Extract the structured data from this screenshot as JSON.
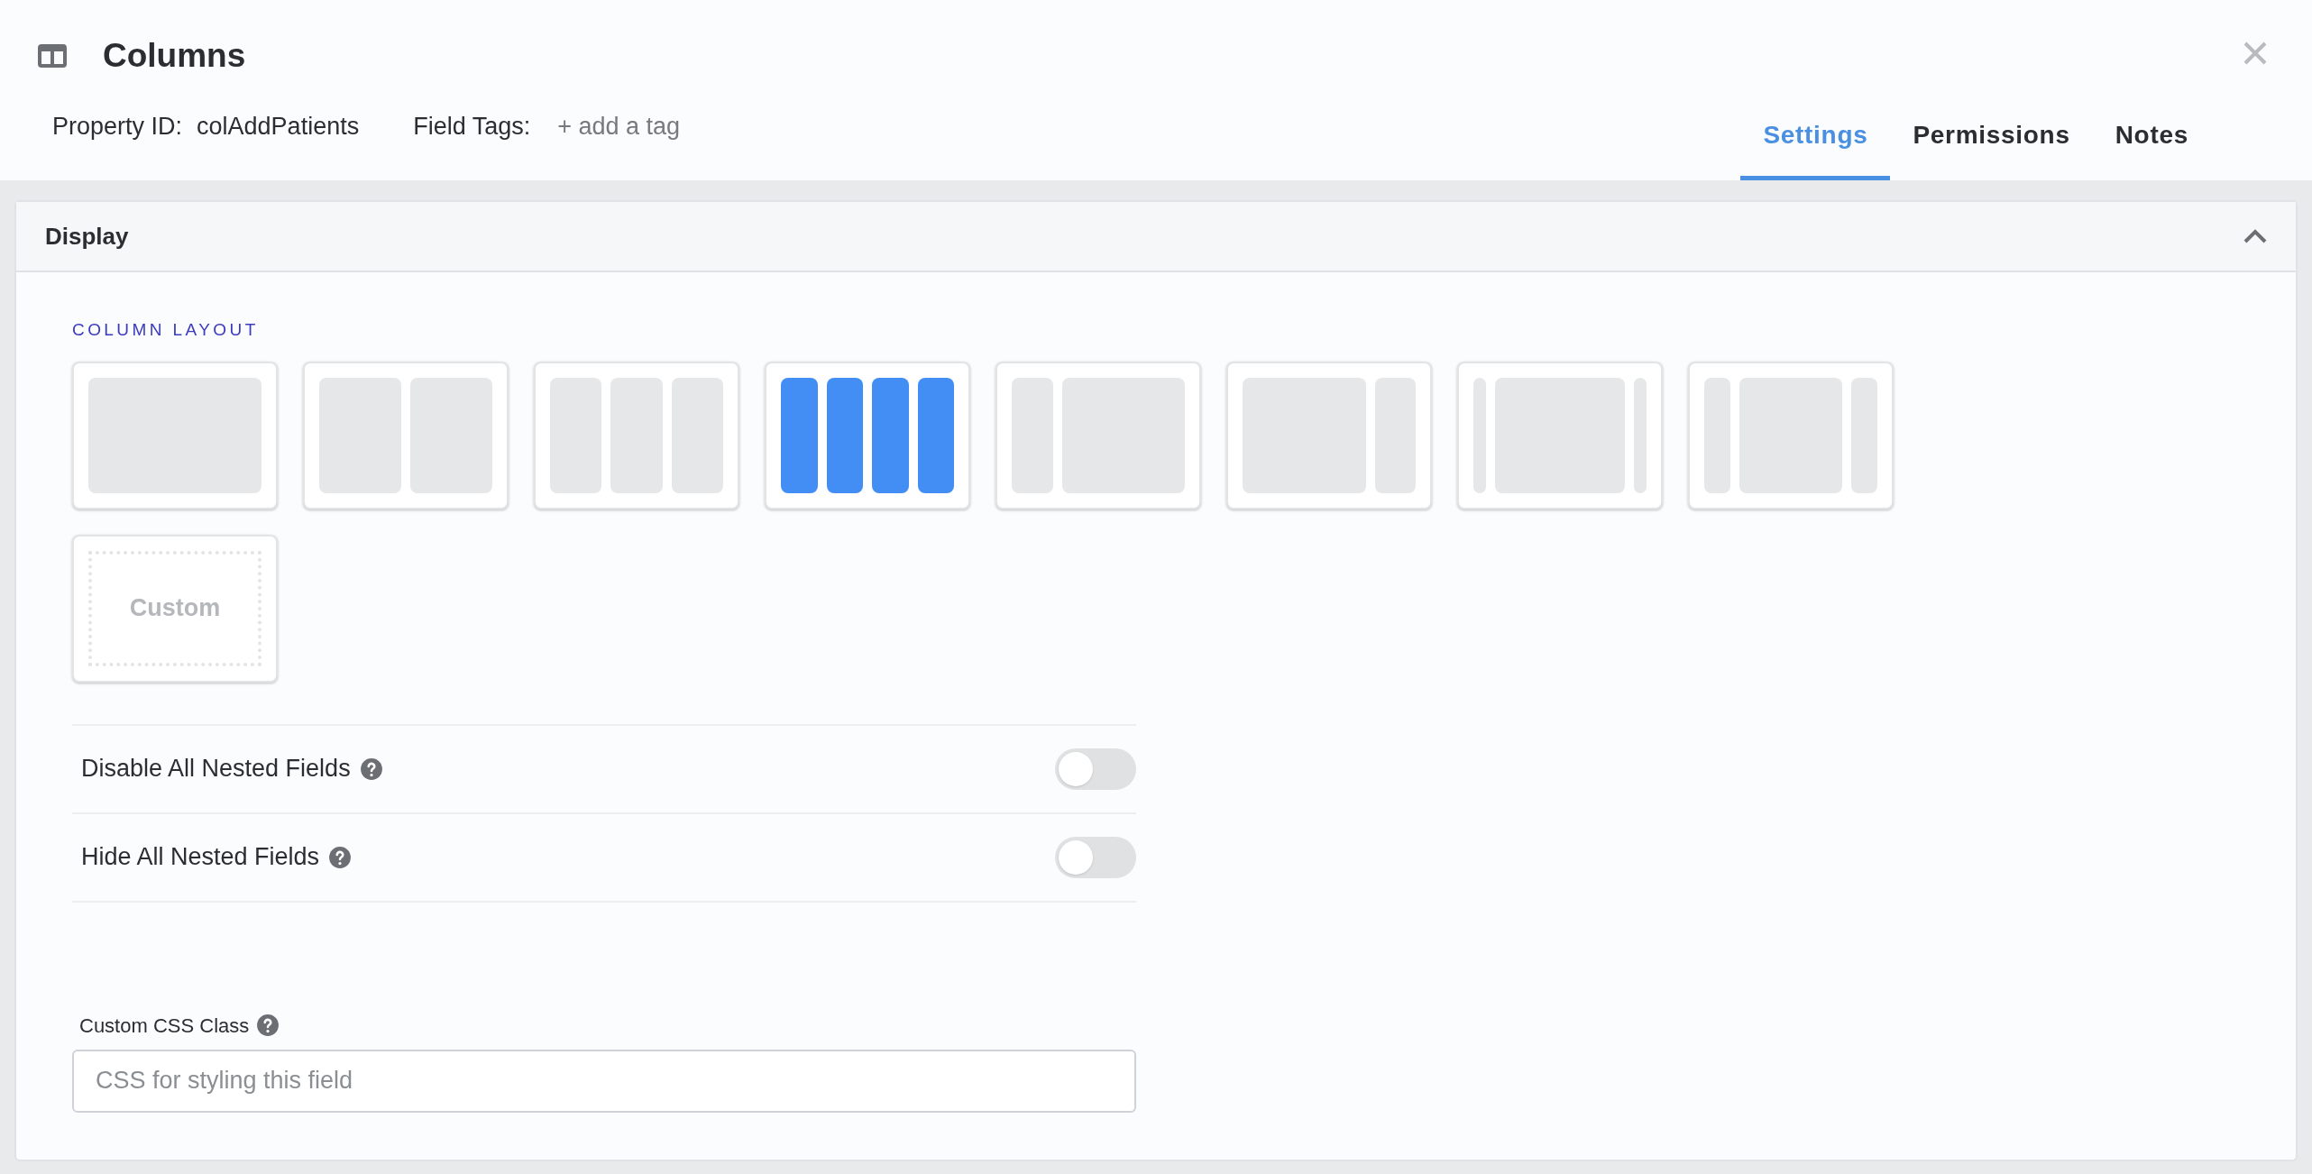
{
  "header": {
    "title": "Columns",
    "property_id_label": "Property ID:",
    "property_id": "colAddPatients",
    "field_tags_label": "Field Tags:",
    "add_tag": "+ add a tag"
  },
  "tabs": [
    {
      "label": "Settings",
      "selected": true
    },
    {
      "label": "Permissions",
      "selected": false
    },
    {
      "label": "Notes",
      "selected": false
    }
  ],
  "panel": {
    "title": "Display",
    "expanded": true
  },
  "column_layout": {
    "label": "COLUMN LAYOUT",
    "options": [
      {
        "kind": "full",
        "selected": false
      },
      {
        "kind": "halves",
        "selected": false
      },
      {
        "kind": "thirds",
        "selected": false
      },
      {
        "kind": "quarters",
        "selected": true
      },
      {
        "kind": "left-sidebar",
        "selected": false
      },
      {
        "kind": "right-sidebar",
        "selected": false
      },
      {
        "kind": "narrow-sides",
        "selected": false
      },
      {
        "kind": "sides",
        "selected": false
      },
      {
        "kind": "custom",
        "label": "Custom",
        "selected": false
      }
    ]
  },
  "toggles": [
    {
      "label": "Disable All Nested Fields",
      "on": false
    },
    {
      "label": "Hide All Nested Fields",
      "on": false
    }
  ],
  "css_class": {
    "label": "Custom CSS Class",
    "placeholder": "CSS for styling this field"
  }
}
